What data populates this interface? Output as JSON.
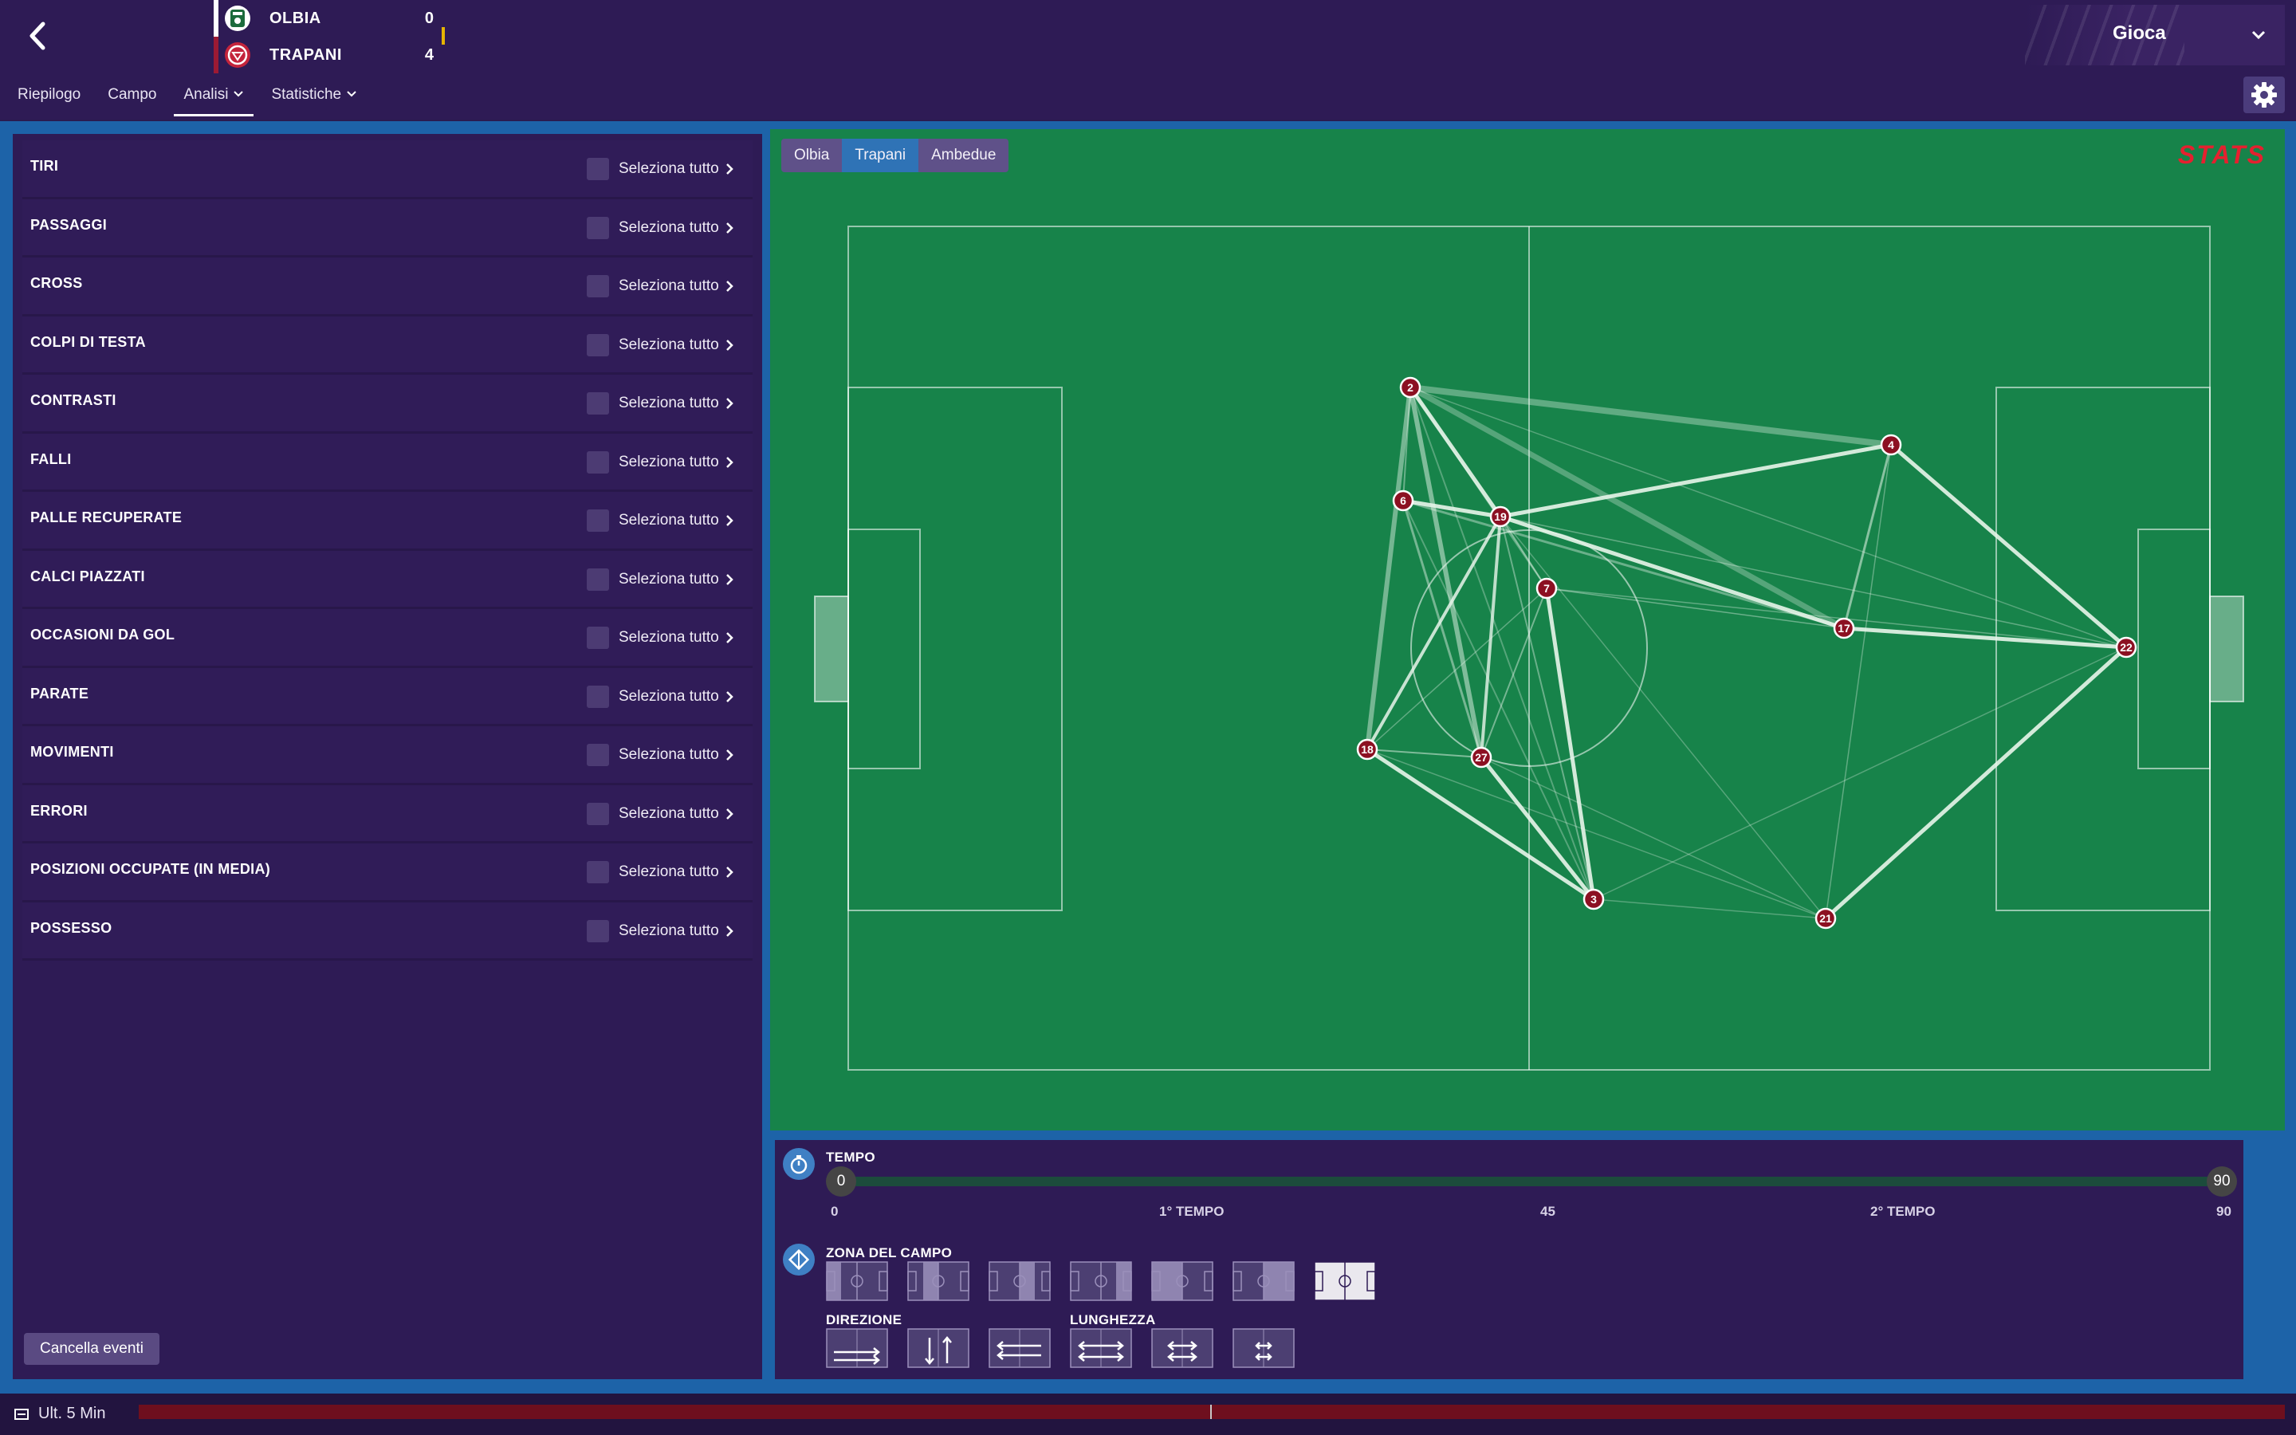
{
  "header": {
    "teams": [
      {
        "name": "OLBIA",
        "score": "0"
      },
      {
        "name": "TRAPANI",
        "score": "4"
      }
    ],
    "play_label": "Gioca",
    "tabs": [
      "Riepilogo",
      "Campo",
      "Analisi",
      "Statistiche"
    ],
    "active_tab": "Analisi"
  },
  "categories": [
    {
      "name": "TIRI",
      "select_label": "Seleziona tutto"
    },
    {
      "name": "PASSAGGI",
      "select_label": "Seleziona tutto"
    },
    {
      "name": "CROSS",
      "select_label": "Seleziona tutto"
    },
    {
      "name": "COLPI DI TESTA",
      "select_label": "Seleziona tutto"
    },
    {
      "name": "CONTRASTI",
      "select_label": "Seleziona tutto"
    },
    {
      "name": "FALLI",
      "select_label": "Seleziona tutto"
    },
    {
      "name": "PALLE RECUPERATE",
      "select_label": "Seleziona tutto"
    },
    {
      "name": "CALCI PIAZZATI",
      "select_label": "Seleziona tutto"
    },
    {
      "name": "OCCASIONI DA GOL",
      "select_label": "Seleziona tutto"
    },
    {
      "name": "PARATE",
      "select_label": "Seleziona tutto"
    },
    {
      "name": "MOVIMENTI",
      "select_label": "Seleziona tutto"
    },
    {
      "name": "ERRORI",
      "select_label": "Seleziona tutto"
    },
    {
      "name": "POSIZIONI OCCUPATE (IN MEDIA)",
      "select_label": "Seleziona tutto"
    },
    {
      "name": "POSSESSO",
      "select_label": "Seleziona tutto"
    }
  ],
  "cancel_label": "Cancella eventi",
  "pitch": {
    "team_toggle": [
      "Olbia",
      "Trapani",
      "Ambedue"
    ],
    "active_team": "Trapani",
    "provider_logo": "STATS",
    "players": [
      "2",
      "4",
      "6",
      "19",
      "7",
      "17",
      "22",
      "18",
      "27",
      "3",
      "21"
    ]
  },
  "filters": {
    "time_title": "TEMPO",
    "time_start": "0",
    "time_end": "90",
    "ticks": [
      "0",
      "1° TEMPO",
      "45",
      "2° TEMPO",
      "90"
    ],
    "zone_title": "ZONA DEL CAMPO",
    "direction_title": "DIREZIONE",
    "length_title": "LUNGHEZZA",
    "selected_zone_index": 6
  },
  "bottom": {
    "label": "Ult. 5 Min"
  },
  "colors": {
    "background": "#2b1b4f",
    "frame_blue": "#1d63a8",
    "pitch_green": "#17834a",
    "player_marker": "#8c1022",
    "timeline": "#6e0f1e",
    "accent_gold": "#e6b400"
  }
}
